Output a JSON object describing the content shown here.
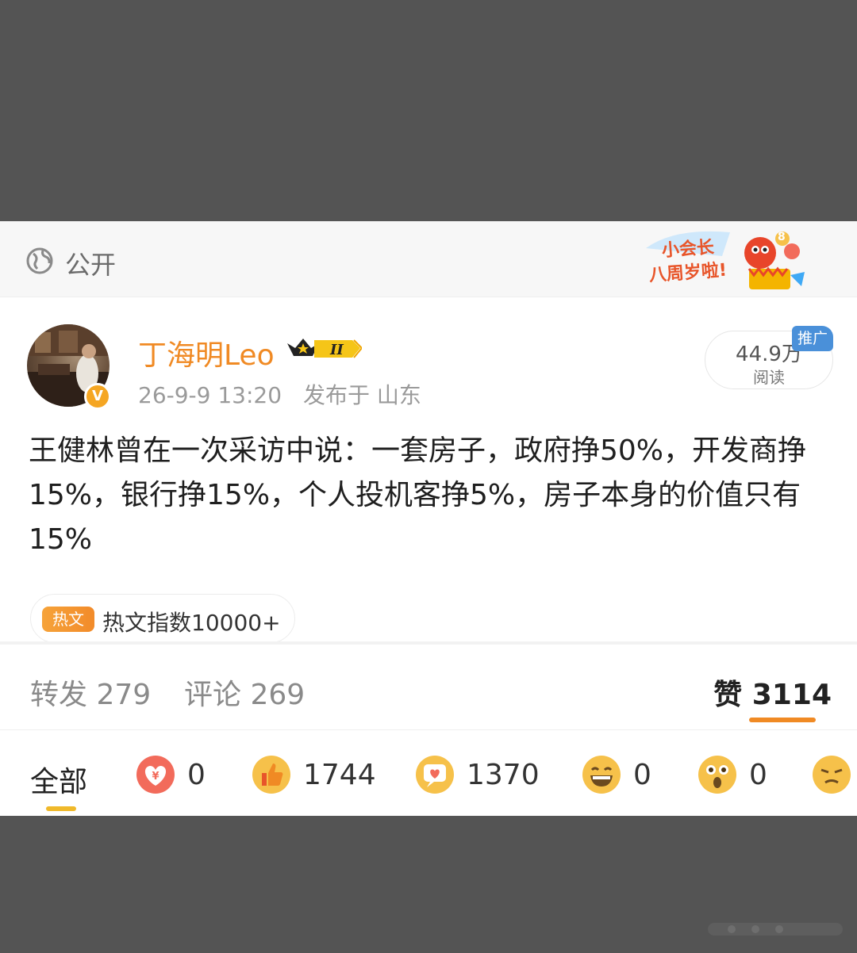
{
  "visibility": {
    "label": "公开",
    "icon": "globe-icon"
  },
  "banner": {
    "line1": "小会长",
    "line2": "八周岁啦!",
    "number": "8"
  },
  "author": {
    "name": "丁海明Leo",
    "level": "II",
    "timestamp": "26-9-9 13:20",
    "location": "发布于 山东"
  },
  "reads": {
    "count": "44.9万",
    "label": "阅读",
    "promo": "推广"
  },
  "post": {
    "text": "王健林曾在一次采访中说：一套房子，政府挣50%，开发商挣15%，银行挣15%，个人投机客挣5%，房子本身的价值只有15%"
  },
  "hot": {
    "tag": "热文",
    "label": "热文指数10000+"
  },
  "stats": {
    "repost": "转发 279",
    "comment": "评论 269",
    "like_label": "赞",
    "like_count": "3114"
  },
  "reactions": {
    "all": "全部",
    "items": [
      {
        "icon": "red-envelope-icon",
        "count": "0"
      },
      {
        "icon": "thumbs-up-icon",
        "count": "1744"
      },
      {
        "icon": "heart-chat-icon",
        "count": "1370"
      },
      {
        "icon": "laughing-face-icon",
        "count": "0"
      },
      {
        "icon": "surprised-face-icon",
        "count": "0"
      }
    ]
  },
  "colors": {
    "accent": "#f08a24",
    "background": "#545454",
    "promo": "#4a90d9"
  }
}
